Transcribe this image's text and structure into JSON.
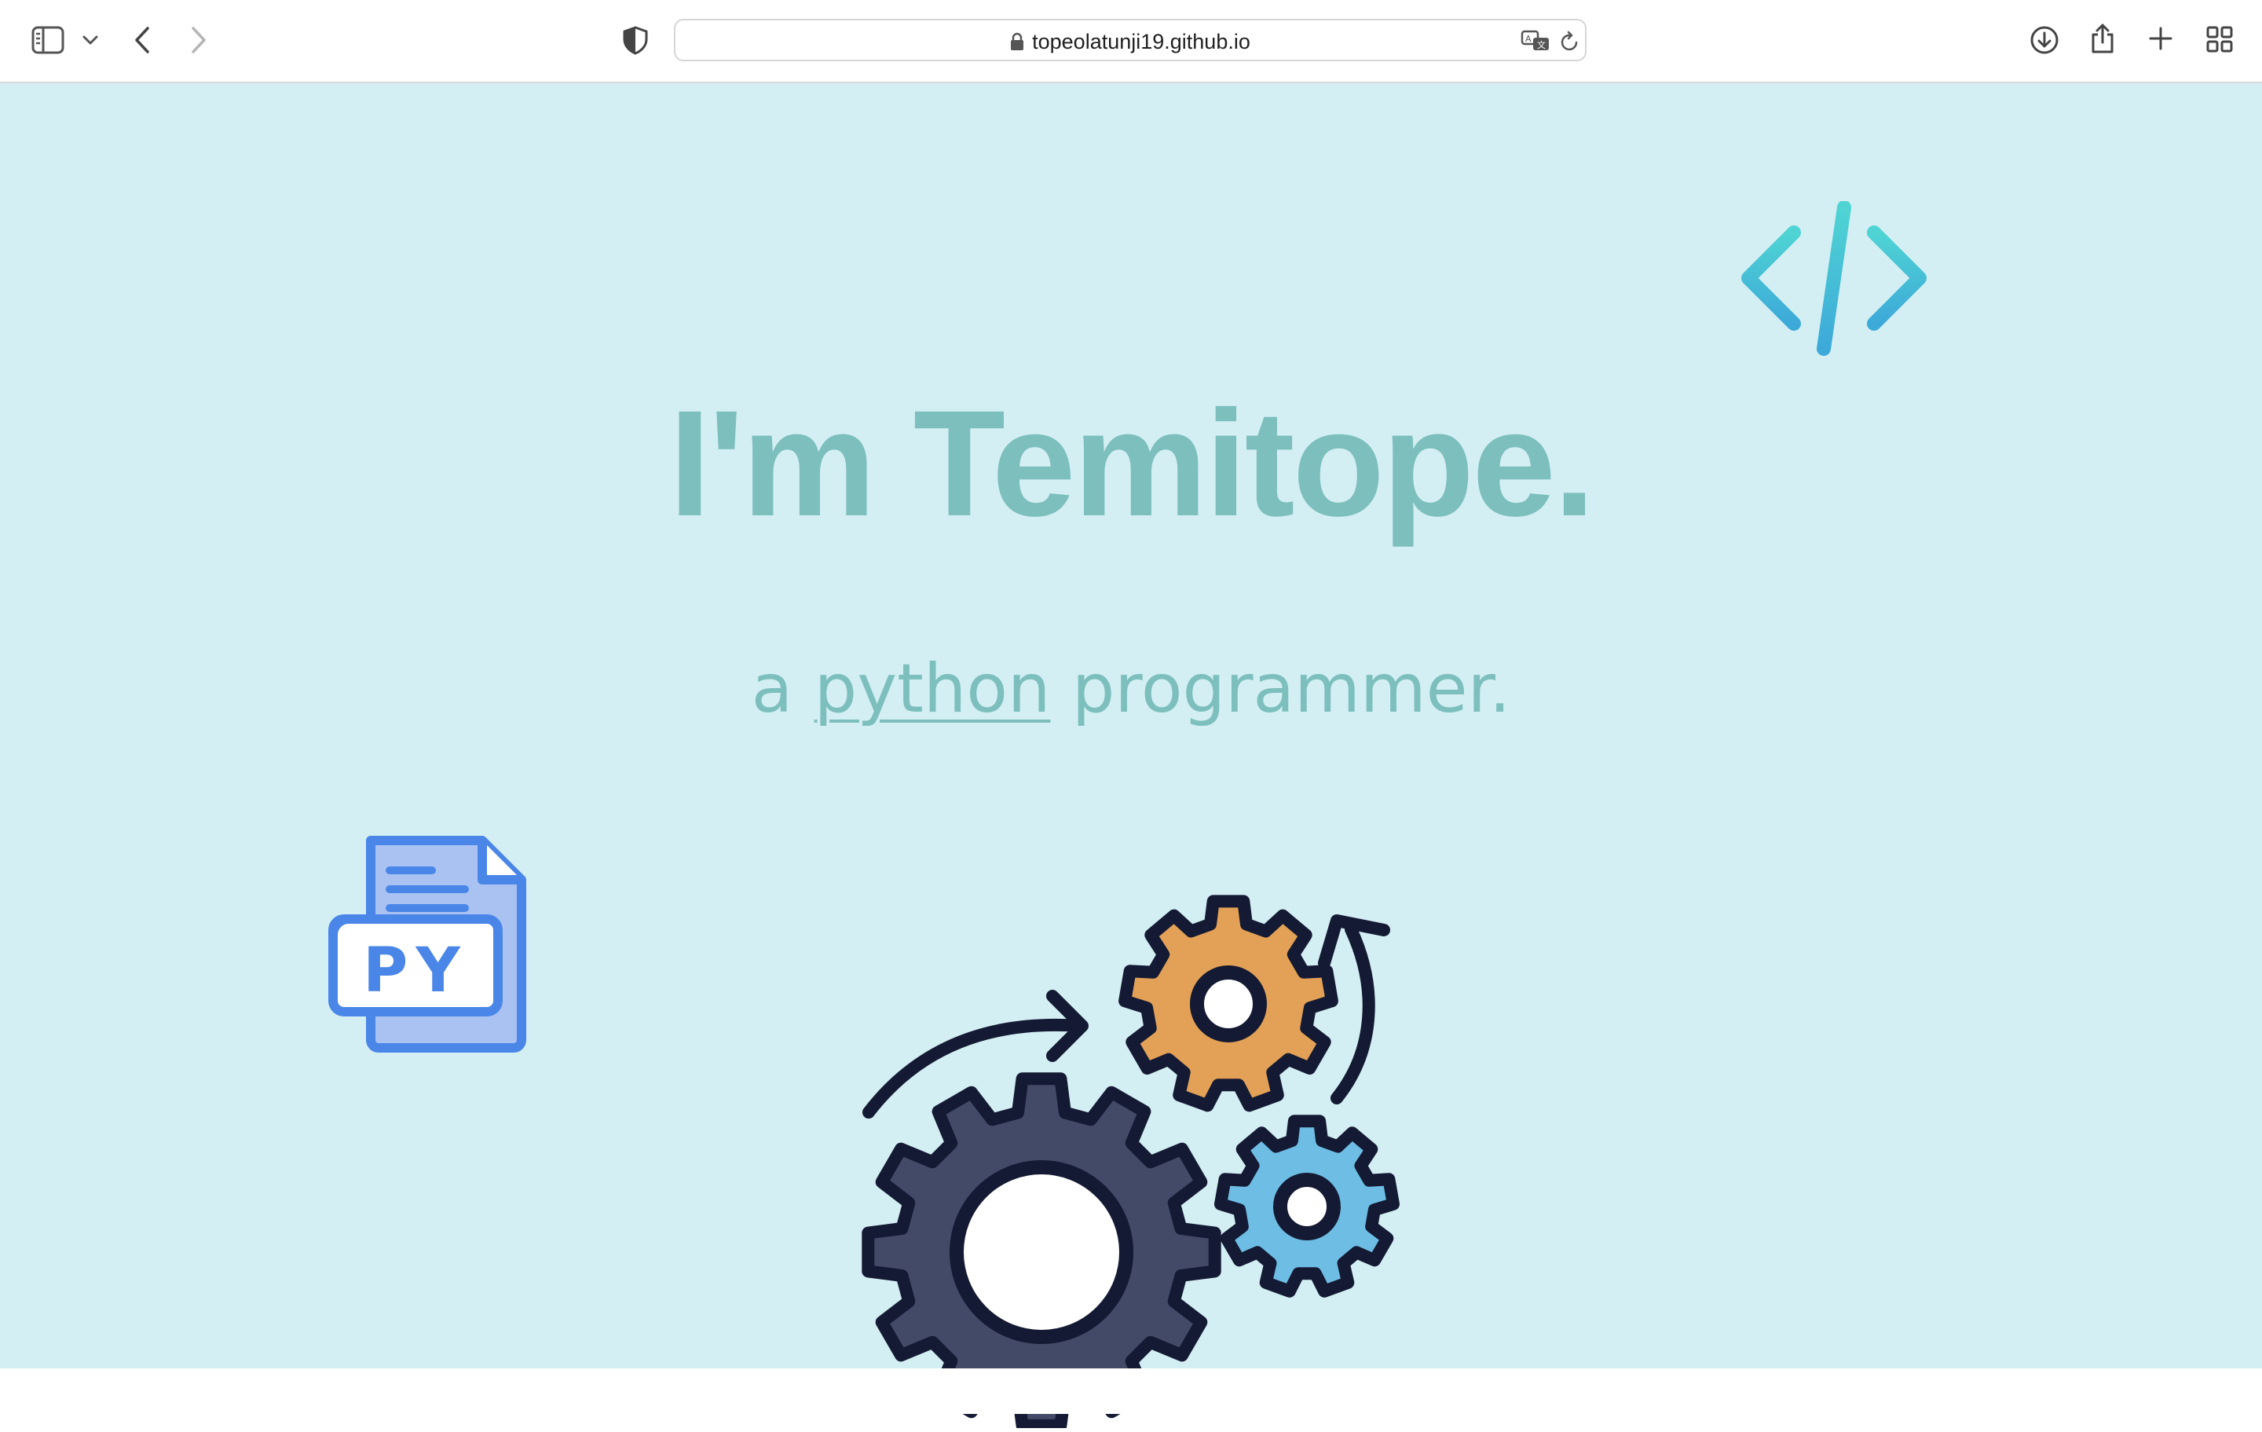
{
  "browser": {
    "url": "topeolatunji19.github.io",
    "icons": [
      "sidebar-icon",
      "chevron-down-icon",
      "back-icon",
      "forward-icon",
      "privacy-shield-icon",
      "lock-icon",
      "translate-icon",
      "reload-icon",
      "download-icon",
      "share-icon",
      "new-tab-icon",
      "tab-overview-icon"
    ]
  },
  "page": {
    "headline": "I'm Temitope.",
    "subline_prefix": "a",
    "subline_language": "python",
    "subline_suffix": "programmer.",
    "py_badge_text": "PY",
    "colors": {
      "background": "#d3eff3",
      "heading": "#7dbfbd",
      "code_icon": "#46c2d6",
      "py_icon": "#4a86e8",
      "gear_dark": "#434a68",
      "gear_orange": "#e2a156",
      "gear_blue": "#6ebde4",
      "outline": "#141a33"
    }
  }
}
